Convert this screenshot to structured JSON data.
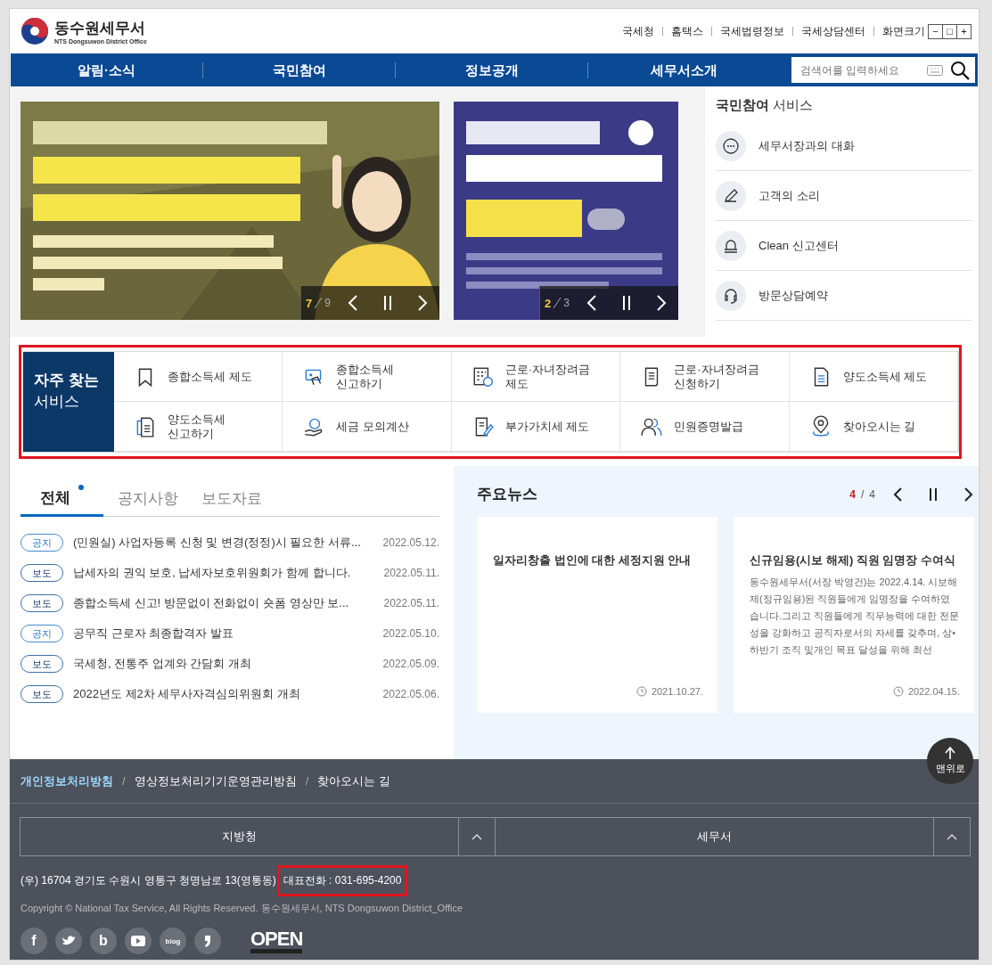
{
  "logo": {
    "name": "동수원세무서",
    "subtitle": "NTS Dongsuwon District Office"
  },
  "top_links": [
    "국세청",
    "홈택스",
    "국세법령정보",
    "국세상담센터"
  ],
  "font_size": {
    "label": "화면크기",
    "buttons": [
      "−",
      "□",
      "+"
    ]
  },
  "nav": [
    "알림·소식",
    "국민참여",
    "정보공개",
    "세무서소개"
  ],
  "search": {
    "placeholder": "검색어를 입력하세요"
  },
  "banners": [
    {
      "current": "7",
      "total": "9"
    },
    {
      "current": "2",
      "total": "3"
    }
  ],
  "citizen_services": {
    "title": "**국민참여** 서비스",
    "items": [
      "세무서장과의 대화",
      "고객의 소리",
      "Clean 신고센터",
      "방문상담예약"
    ]
  },
  "quick_services": {
    "title": "**자주 찾는** 서비스",
    "highlighted": true,
    "items": [
      {
        "lines": [
          "종합소득세 제도"
        ]
      },
      {
        "lines": [
          "종합소득세",
          "신고하기"
        ]
      },
      {
        "lines": [
          "근로·자녀장려금",
          "제도"
        ]
      },
      {
        "lines": [
          "근로·자녀장려금",
          "신청하기"
        ]
      },
      {
        "lines": [
          "양도소득세 제도"
        ]
      },
      {
        "lines": [
          "양도소득세",
          "신고하기"
        ]
      },
      {
        "lines": [
          "세금 모의계산"
        ]
      },
      {
        "lines": [
          "부가가치세 제도"
        ]
      },
      {
        "lines": [
          "민원증명발급"
        ]
      },
      {
        "lines": [
          "찾아오시는 길"
        ]
      }
    ]
  },
  "notices": {
    "tabs": [
      {
        "label": "전체",
        "selected": true,
        "new": true
      },
      {
        "label": "공지사항",
        "selected": false,
        "new": false
      },
      {
        "label": "보도자료",
        "selected": false,
        "new": false
      }
    ],
    "rows": [
      {
        "kind": "notice",
        "tag": "공지",
        "title": "(민원실) 사업자등록 신청 및 변경(정정)시 필요한 서류...",
        "date": "2022.05.12."
      },
      {
        "kind": "press",
        "tag": "보도",
        "title": "납세자의 권익 보호, 납세자보호위원회가 함께 합니다.",
        "date": "2022.05.11."
      },
      {
        "kind": "press",
        "tag": "보도",
        "title": "종합소득세 신고! 방문없이 전화없이 숏폼 영상만 보...",
        "date": "2022.05.11."
      },
      {
        "kind": "notice",
        "tag": "공지",
        "title": "공무직 근로자 최종합격자 발표",
        "date": "2022.05.10."
      },
      {
        "kind": "press",
        "tag": "보도",
        "title": "국세청, 전통주 업계와 간담회 개최",
        "date": "2022.05.09."
      },
      {
        "kind": "press",
        "tag": "보도",
        "title": "2022년도 제2차 세무사자격심의위원회 개최",
        "date": "2022.05.06."
      }
    ]
  },
  "news": {
    "title": "주요뉴스",
    "current": "4",
    "separator": "/",
    "total": "4",
    "cards": [
      {
        "title": "일자리창출 법인에 대한 세정지원 안내",
        "date": "2021.10.27."
      },
      {
        "title": "신규임용(시보 해제) 직원 임명장 수여식",
        "body": "동수원세무서(서장 박영건)는 2022.4.14. 시보해제(정규임용)된 직원들에게 임명장을 수여하였습니다.그리고 직원들에게 직무능력에 대한 전문성을 강화하고 공직자로서의 자세를 갖추며, 상•하반기 조직 및개인 목표 달성을 위해 최선",
        "date": "2022.04.15."
      }
    ]
  },
  "top_button": "맨위로",
  "footer": {
    "links": [
      {
        "label": "개인정보처리방침",
        "emphasized": true
      },
      {
        "label": "영상정보처리기기운영관리방침",
        "emphasized": false
      },
      {
        "label": "찾아오시는 길",
        "emphasized": false
      }
    ],
    "separator": "/",
    "dropdowns": [
      "지방청",
      "세무서"
    ],
    "address": "(우) 16704 경기도 수원시 영통구 청명남로 13(영통동)",
    "phone": {
      "text": "대표전화 : 031-695-4200",
      "highlighted": true
    },
    "copyright": "Copyright © National Tax Service, All Rights Reserved. 동수원세무서, NTS Dongsuwon District_Office",
    "social": [
      {
        "kind": "letter",
        "glyph": "f"
      },
      {
        "kind": "bird"
      },
      {
        "kind": "letter",
        "glyph": "b"
      },
      {
        "kind": "play"
      },
      {
        "kind": "bubble",
        "glyph": "blog"
      },
      {
        "kind": "comma"
      }
    ],
    "open_logo": "OPEN"
  }
}
